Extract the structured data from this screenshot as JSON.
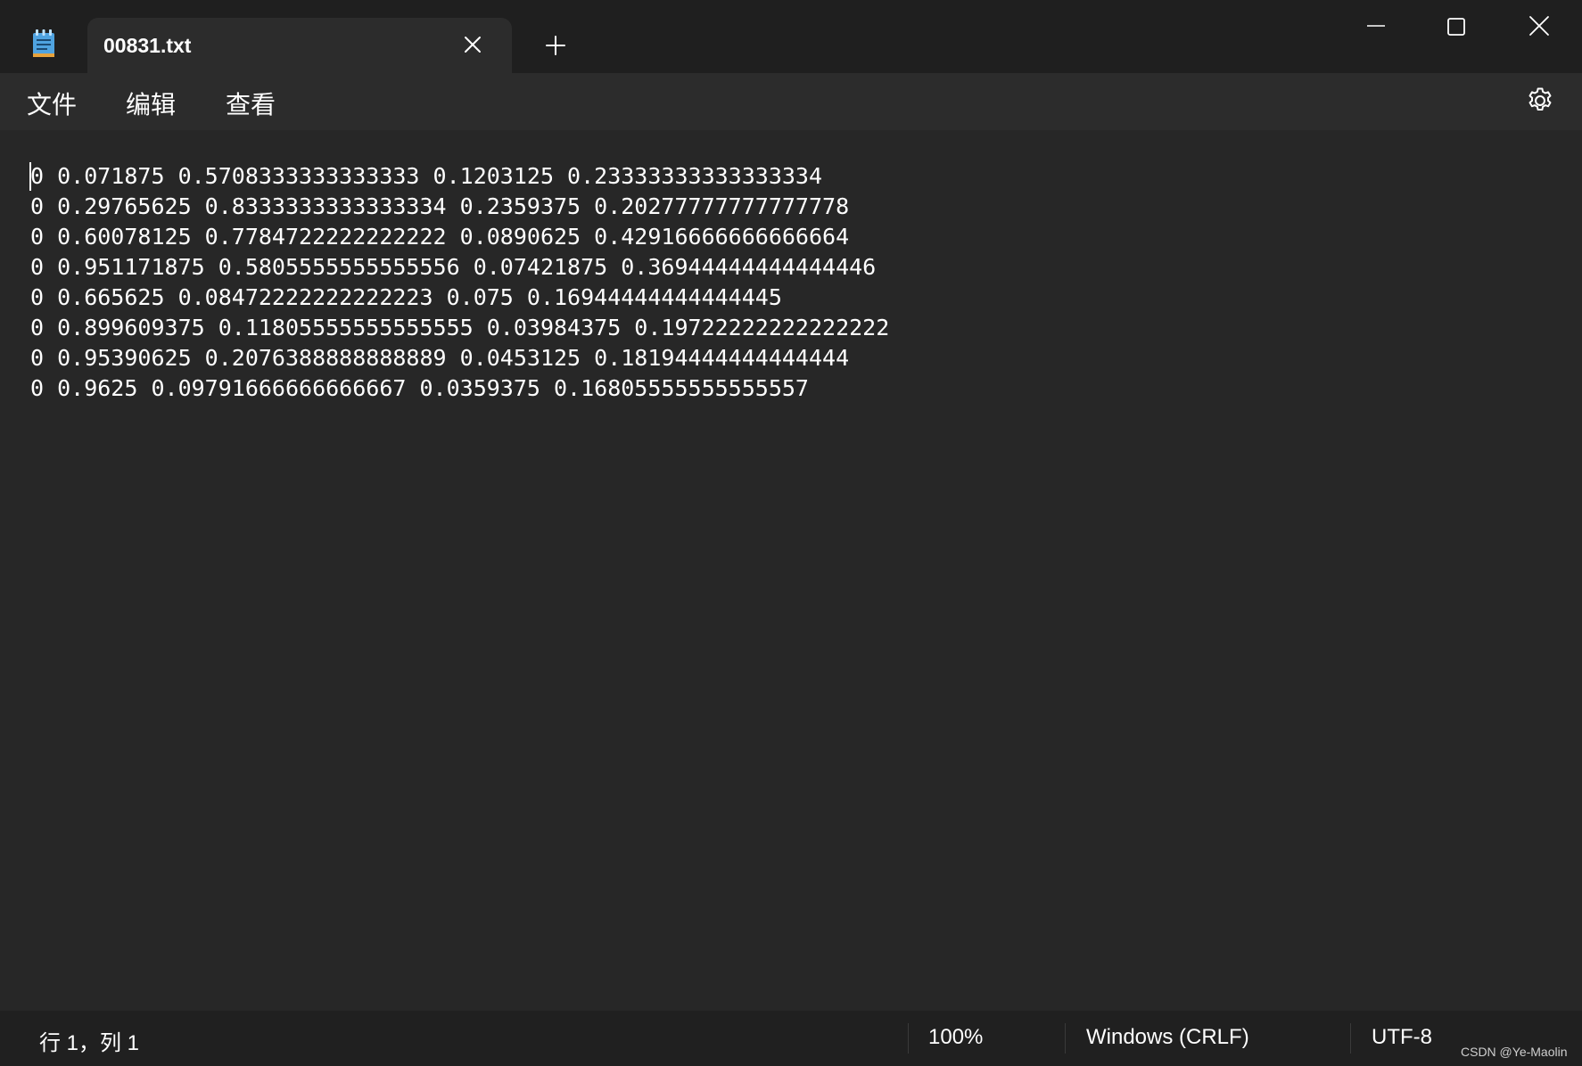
{
  "titlebar": {
    "tab_title": "00831.txt",
    "icons": {
      "app": "notepad-icon",
      "tab_close": "close-icon",
      "new_tab": "plus-icon",
      "minimize": "minimize-icon",
      "maximize": "maximize-icon",
      "close": "close-icon"
    }
  },
  "menu": {
    "items": [
      "文件",
      "编辑",
      "查看"
    ],
    "settings_icon": "gear-icon"
  },
  "editor": {
    "lines": [
      "0 0.071875 0.5708333333333333 0.1203125 0.23333333333333334",
      "0 0.29765625 0.8333333333333334 0.2359375 0.20277777777777778",
      "0 0.60078125 0.7784722222222222 0.0890625 0.42916666666666664",
      "0 0.951171875 0.5805555555555556 0.07421875 0.36944444444444446",
      "0 0.665625 0.08472222222222223 0.075 0.16944444444444445",
      "0 0.899609375 0.11805555555555555 0.03984375 0.19722222222222222",
      "0 0.95390625 0.2076388888888889 0.0453125 0.18194444444444444",
      "0 0.9625 0.09791666666666667 0.0359375 0.16805555555555557"
    ]
  },
  "statusbar": {
    "position": "行 1，列 1",
    "zoom": "100%",
    "line_ending": "Windows (CRLF)",
    "encoding": "UTF-8",
    "watermark": "CSDN @Ye-Maolin"
  },
  "colors": {
    "titlebar_bg": "#1f1f1f",
    "tab_bg": "#2c2c2c",
    "editor_bg": "#272727",
    "statusbar_bg": "#202020",
    "text": "#ffffff",
    "icon_accent": "#4fa3e0"
  }
}
